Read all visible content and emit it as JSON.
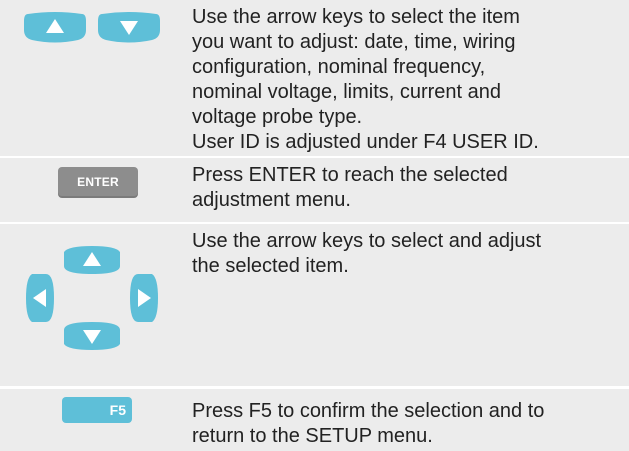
{
  "colors": {
    "background": "#ffffff",
    "row_fill": "#ececec",
    "key_blue": "#5ebfd8",
    "key_gray": "#8d8d8d",
    "key_text": "#ffffff",
    "body_text": "#222222"
  },
  "rows": [
    {
      "icon": "up-down-arrow-keys-icon",
      "lines": [
        "Use the arrow keys to select the item",
        "you want to adjust: date, time, wiring",
        "configuration, nominal frequency,",
        "nominal voltage, limits, current and",
        "voltage probe type.",
        "User ID is adjusted under F4 USER ID."
      ]
    },
    {
      "icon": "enter-key-icon",
      "key_label": "ENTER",
      "lines": [
        "Press ENTER to reach the selected",
        "adjustment menu."
      ]
    },
    {
      "icon": "four-way-arrow-keys-icon",
      "lines": [
        "Use the arrow keys to select and adjust",
        "the selected item."
      ]
    },
    {
      "icon": "f5-key-icon",
      "key_label": "F5",
      "lines": [
        "Press F5 to confirm the selection and to",
        "return to the SETUP menu."
      ]
    }
  ]
}
